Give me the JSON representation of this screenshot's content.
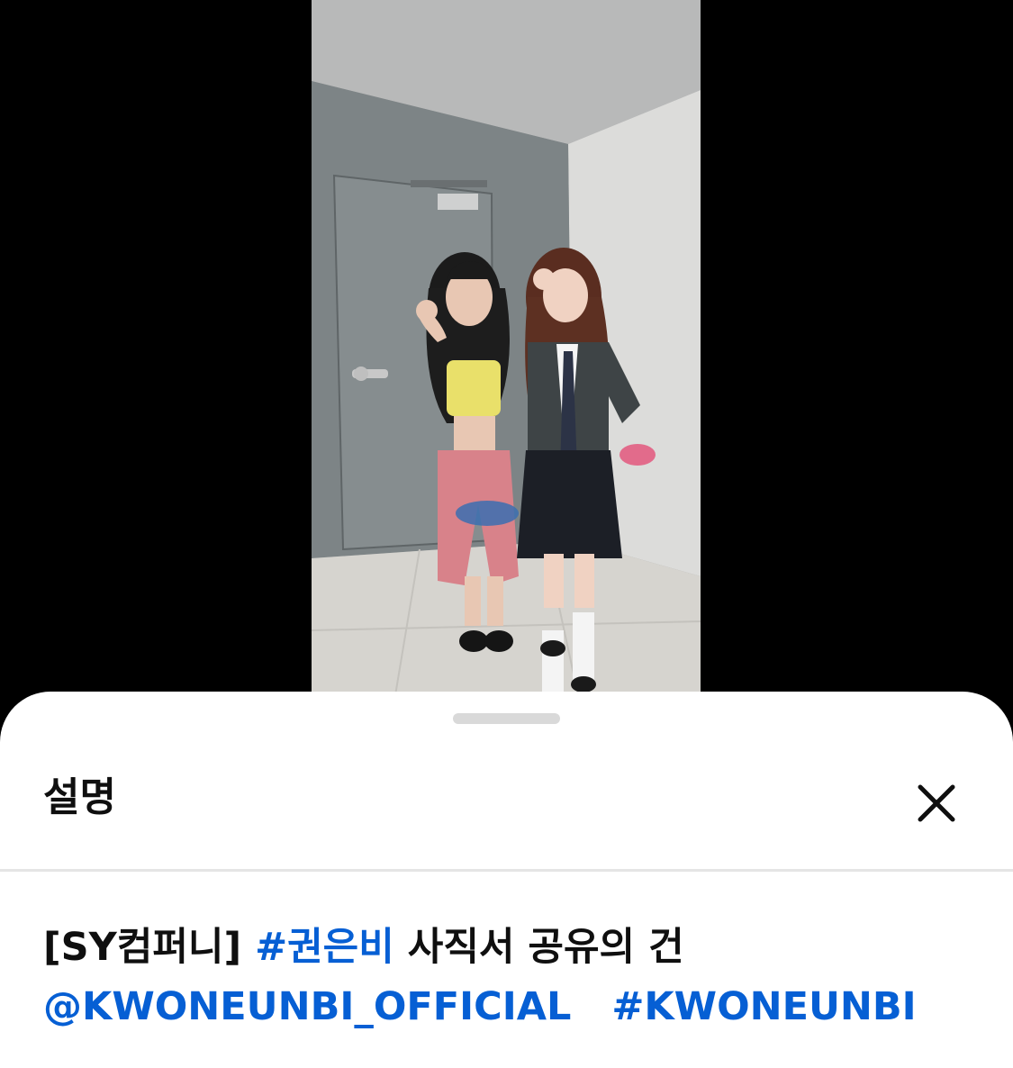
{
  "sheet": {
    "title": "설명",
    "close_icon": "close-icon"
  },
  "description": {
    "line1": {
      "prefix": "[SY컴퍼니]",
      "hashtag": "#권은비",
      "suffix": "사직서 공유의 건"
    },
    "line2": {
      "mention": "@KWONEUNBI_OFFICIAL",
      "hashtag": "#KWONEUNBI"
    }
  },
  "colors": {
    "link": "#065fd4",
    "text": "#0f0f0f",
    "sheet_bg": "#ffffff",
    "handle": "#d9d9d9",
    "divider": "#e5e5e5",
    "letterbox": "#000000"
  }
}
